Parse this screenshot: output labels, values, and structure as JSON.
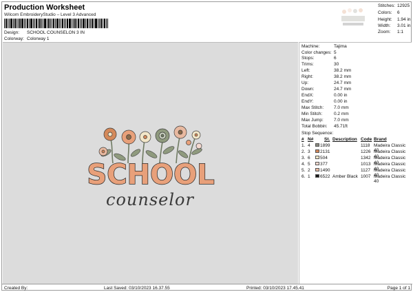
{
  "header": {
    "title": "Production Worksheet",
    "software": "Wilcom EmbroideryStudio – Level 3 Advanced",
    "design_label": "Design:",
    "design_value": "SCHOOL COUNSELON 3 IN",
    "colorway_label": "Colorway:",
    "colorway_value": "Colorway 1"
  },
  "stats": {
    "stitches_label": "Stitches:",
    "stitches_value": "12925",
    "colors_label": "Colors:",
    "colors_value": "6",
    "height_label": "Height:",
    "height_value": "1.94 in",
    "width_label": "Width:",
    "width_value": "3.01 in",
    "zoom_label": "Zoom:",
    "zoom_value": "1:1"
  },
  "artwork": {
    "word1": "SCHOOL",
    "word2": "counselor"
  },
  "info": {
    "machine_label": "Machine:",
    "machine_value": "Tajima",
    "color_changes_label": "Color changes:",
    "color_changes_value": "5",
    "stops_label": "Stops:",
    "stops_value": "6",
    "trims_label": "Trims:",
    "trims_value": "30",
    "left_label": "Left:",
    "left_value": "38.2 mm",
    "right_label": "Right:",
    "right_value": "38.2 mm",
    "up_label": "Up:",
    "up_value": "24.7 mm",
    "down_label": "Down:",
    "down_value": "24.7 mm",
    "endx_label": "EndX:",
    "endx_value": "0.00 in",
    "endy_label": "EndY:",
    "endy_value": "0.00 in",
    "max_stitch_label": "Max Stitch:",
    "max_stitch_value": "7.0 mm",
    "min_stitch_label": "Min Stitch:",
    "min_stitch_value": "0.2 mm",
    "max_jump_label": "Max Jump:",
    "max_jump_value": "7.0 mm",
    "total_bobbin_label": "Total Bobbin:",
    "total_bobbin_value": "45.71ft"
  },
  "stop_sequence": {
    "title": "Stop Sequence:",
    "headers": {
      "num": "#",
      "n": "N#",
      "st": "St.",
      "description": "Description",
      "code": "Code",
      "brand": "Brand"
    },
    "rows": [
      {
        "num": "1.",
        "n": "4",
        "color": "#8a8a80",
        "st": "1899",
        "description": "",
        "code": "1118",
        "brand": "Madeira Classic 40"
      },
      {
        "num": "2.",
        "n": "3",
        "color": "#d4895a",
        "st": "2131",
        "description": "",
        "code": "1226",
        "brand": "Madeira Classic 40"
      },
      {
        "num": "3.",
        "n": "6",
        "color": "#f2e6c8",
        "st": "504",
        "description": "",
        "code": "1342",
        "brand": "Madeira Classic 40"
      },
      {
        "num": "4.",
        "n": "5",
        "color": "#f4d9cf",
        "st": "377",
        "description": "",
        "code": "1013",
        "brand": "Madeira Classic 40"
      },
      {
        "num": "5.",
        "n": "2",
        "color": "#e8b9a0",
        "st": "1490",
        "description": "",
        "code": "1127",
        "brand": "Madeira Classic 40"
      },
      {
        "num": "6.",
        "n": "1",
        "color": "#1a1a1a",
        "st": "6522",
        "description": "Amber Black",
        "code": "1007",
        "brand": "Madeira Classic 40"
      }
    ]
  },
  "footer": {
    "created_by": "Created By:",
    "last_saved": "Last Saved: 03/10/2023 16.37.55",
    "printed": "Printed: 03/10/2023 17.45.41",
    "page": "Page 1 of 1"
  }
}
